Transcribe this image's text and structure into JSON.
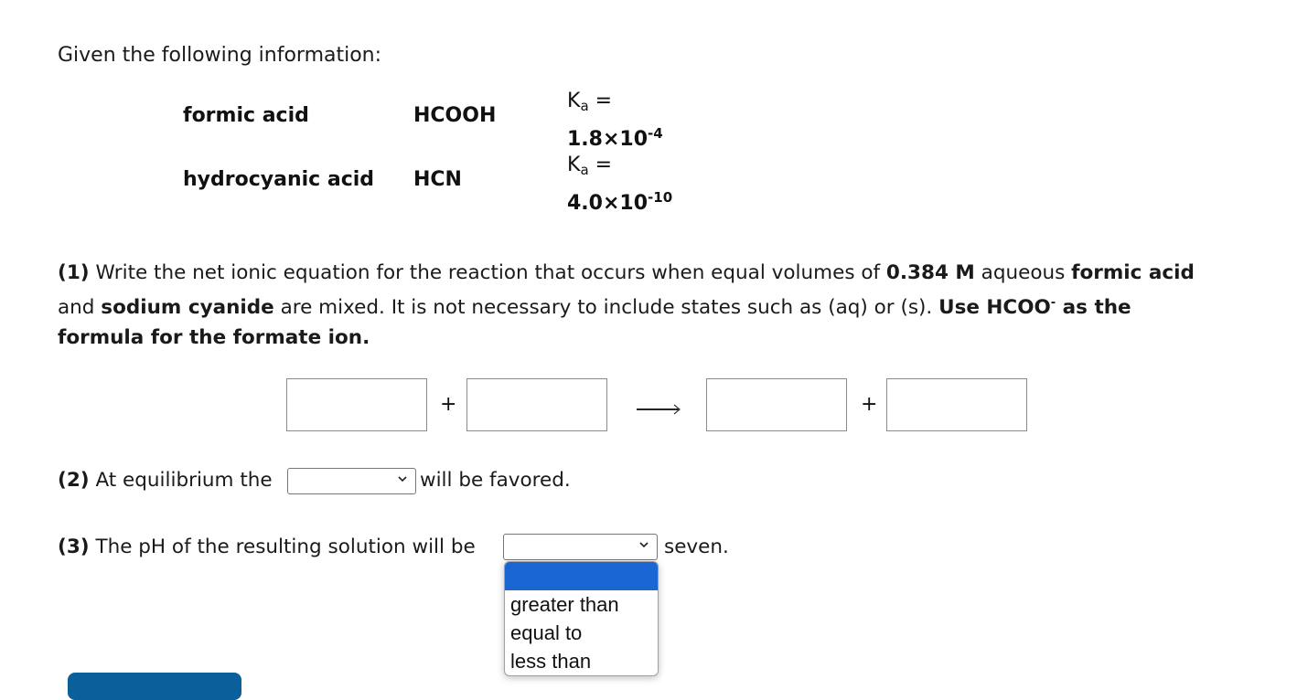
{
  "intro": "Given the following information:",
  "acids": [
    {
      "name": "formic acid",
      "formula": "HCOOH",
      "ka_label": "K",
      "ka_sub": "a",
      "ka_eq": " =",
      "ka_mantissa": "1.8×10",
      "ka_exp": "-4"
    },
    {
      "name": "hydrocyanic acid",
      "formula": "HCN",
      "ka_label": "K",
      "ka_sub": "a",
      "ka_eq": " =",
      "ka_mantissa": "4.0×10",
      "ka_exp": "-10"
    }
  ],
  "q1": {
    "num": "(1)",
    "t1": " Write the net ionic equation for the reaction that occurs when equal volumes of ",
    "b1": "0.384 M",
    "t2": " aqueous ",
    "b2": "formic acid",
    "t3": "and ",
    "b3": "sodium cyanide",
    "t4": " are mixed. It is not necessary to include states such as (aq) or (s). ",
    "b4a": "Use HCOO",
    "b4sup": "-",
    "b4b": " as the",
    "b5": "formula for the formate ion."
  },
  "equation": {
    "plus": "+",
    "inputs": [
      "",
      "",
      "",
      ""
    ]
  },
  "q2": {
    "num": "(2)",
    "before": " At equilibrium the",
    "after": "will be favored.",
    "selected": ""
  },
  "q3": {
    "num": "(3)",
    "before": " The pH of the resulting solution will be",
    "after": "seven.",
    "selected": "",
    "options": [
      "",
      "greater than",
      "equal to",
      "less than"
    ]
  },
  "colors": {
    "highlight": "#1a66d2",
    "submit": "#0b5f9a"
  }
}
